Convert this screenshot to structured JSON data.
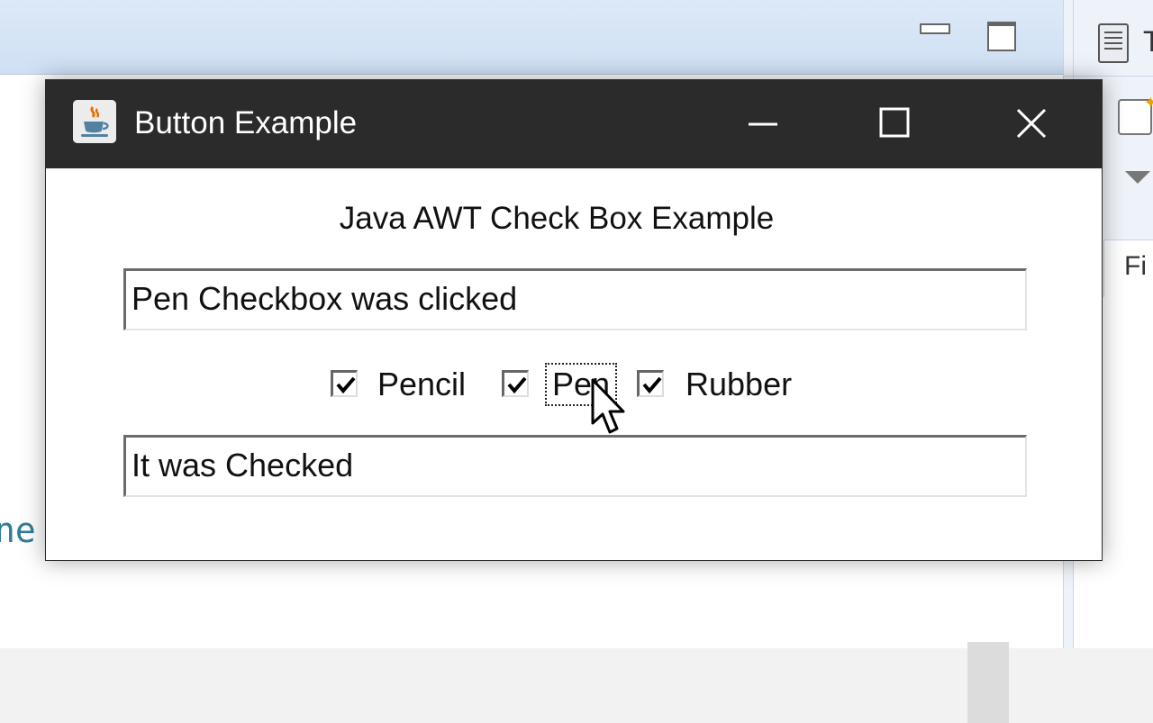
{
  "background": {
    "editor_text_fragment": "ne",
    "right_panel_label_t": "T",
    "right_panel_label_fi": "Fi"
  },
  "window": {
    "title": "Button Example",
    "icon": "java-cup-icon",
    "controls": [
      "minimize-icon",
      "maximize-icon",
      "close-icon"
    ]
  },
  "content": {
    "heading": "Java AWT Check Box Example",
    "textfield_top": "Pen Checkbox was clicked",
    "textfield_bottom": "It was Checked",
    "checkboxes": [
      {
        "label": "Pencil",
        "checked": true
      },
      {
        "label": "Pen",
        "checked": true,
        "focused": true
      },
      {
        "label": "Rubber",
        "checked": true
      }
    ]
  },
  "colors": {
    "titlebar": "#2b2b2b",
    "title_text": "#ffffff",
    "content_bg": "#ffffff"
  }
}
